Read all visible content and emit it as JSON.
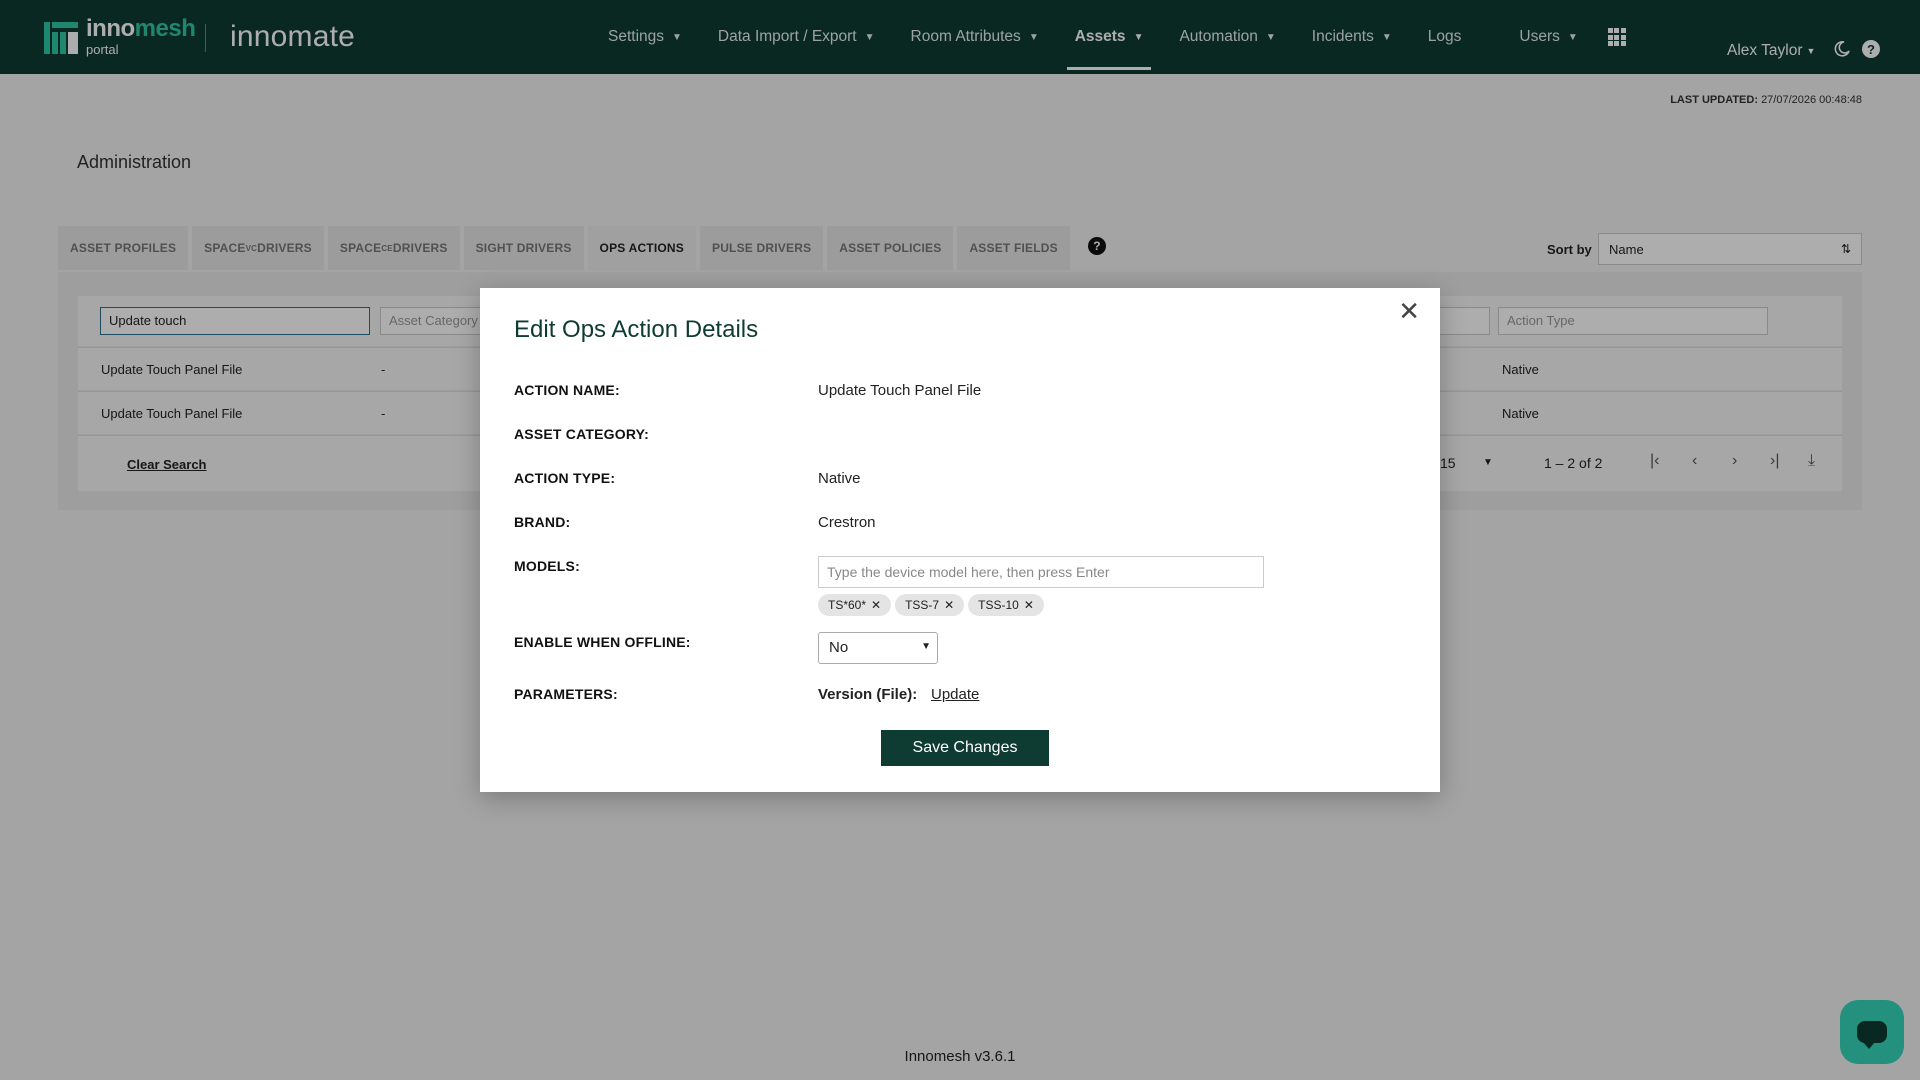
{
  "header": {
    "brand_inno": "inno",
    "brand_mesh": "mesh",
    "brand_sub": "portal",
    "app_name": "innomate",
    "nav": [
      {
        "label": "Settings",
        "dropdown": true
      },
      {
        "label": "Data Import / Export",
        "dropdown": true
      },
      {
        "label": "Room Attributes",
        "dropdown": true
      },
      {
        "label": "Assets",
        "dropdown": true,
        "active": true
      },
      {
        "label": "Automation",
        "dropdown": true
      },
      {
        "label": "Incidents",
        "dropdown": true
      },
      {
        "label": "Logs",
        "dropdown": false
      },
      {
        "label": "Users",
        "dropdown": true
      }
    ],
    "user_name": "Alex Taylor"
  },
  "last_updated": {
    "label": "LAST UPDATED:",
    "value": "27/07/2026 00:48:48"
  },
  "page_title": "Administration",
  "tabs": [
    {
      "pre": "ASSET PROFILES",
      "sup": "",
      "post": ""
    },
    {
      "pre": "SPACE",
      "sup": "VC",
      "post": " DRIVERS"
    },
    {
      "pre": "SPACE",
      "sup": "CE",
      "post": " DRIVERS"
    },
    {
      "pre": "SIGHT DRIVERS",
      "sup": "",
      "post": ""
    },
    {
      "pre": "OPS ACTIONS",
      "sup": "",
      "post": "",
      "active": true
    },
    {
      "pre": "PULSE DRIVERS",
      "sup": "",
      "post": ""
    },
    {
      "pre": "ASSET POLICIES",
      "sup": "",
      "post": ""
    },
    {
      "pre": "ASSET FIELDS",
      "sup": "",
      "post": ""
    }
  ],
  "sort": {
    "label": "Sort by",
    "value": "Name"
  },
  "filters": {
    "name_value": "Update touch",
    "category_placeholder": "Asset Category",
    "type_placeholder": "Action Type"
  },
  "rows": [
    {
      "name": "Update Touch Panel File",
      "category": "-",
      "type": "Native"
    },
    {
      "name": "Update Touch Panel File",
      "category": "-",
      "type": "Native"
    }
  ],
  "table_footer": {
    "clear_search": "Clear Search",
    "per_page": "15",
    "page_info": "1 – 2 of 2"
  },
  "modal": {
    "title": "Edit Ops Action Details",
    "fields": {
      "action_name_label": "ACTION NAME:",
      "action_name_value": "Update Touch Panel File",
      "asset_category_label": "ASSET CATEGORY:",
      "asset_category_value": "",
      "action_type_label": "ACTION TYPE:",
      "action_type_value": "Native",
      "brand_label": "BRAND:",
      "brand_value": "Crestron",
      "models_label": "MODELS:",
      "models_placeholder": "Type the device model here, then press Enter",
      "models": [
        "TS*60*",
        "TSS-7",
        "TSS-10"
      ],
      "offline_label": "ENABLE WHEN OFFLINE:",
      "offline_value": "No",
      "parameters_label": "PARAMETERS:",
      "param_name": "Version (File):",
      "param_link": "Update"
    },
    "save_label": "Save Changes"
  },
  "version": "Innomesh v3.6.1",
  "colors": {
    "brand_dark": "#0e3b32",
    "accent": "#2fc7a6",
    "chat": "#35d6bc"
  }
}
